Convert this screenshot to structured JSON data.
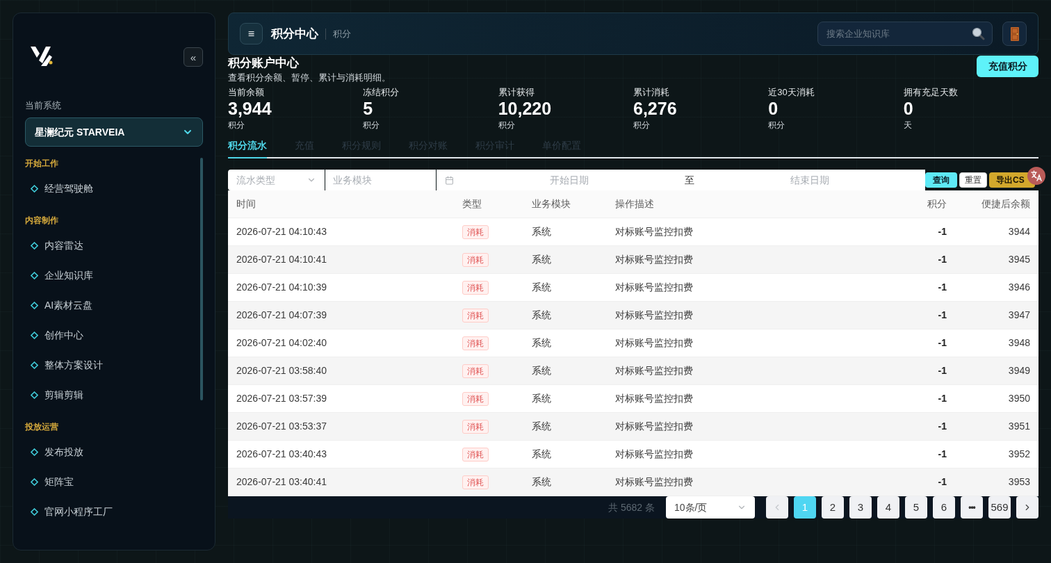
{
  "sidebar": {
    "collapse_button": "«",
    "system_label": "当前系统",
    "system_select": {
      "value": "星澜纪元 STARVEIA"
    },
    "sections": [
      {
        "title": "开始工作",
        "items": [
          {
            "label": "经营驾驶舱",
            "selected": false
          }
        ]
      },
      {
        "title": "内容制作",
        "items": [
          {
            "label": "内容雷达",
            "selected": false
          },
          {
            "label": "企业知识库",
            "selected": false
          },
          {
            "label": "AI素材云盘",
            "selected": false
          },
          {
            "label": "创作中心",
            "selected": false
          },
          {
            "label": "整体方案设计",
            "selected": false
          },
          {
            "label": "剪辑剪辑",
            "selected": false
          }
        ]
      },
      {
        "title": "投放运营",
        "items": [
          {
            "label": "发布投放",
            "selected": false
          },
          {
            "label": "矩阵宝",
            "selected": false
          },
          {
            "label": "官网小程序工厂",
            "selected": false
          }
        ]
      }
    ]
  },
  "header": {
    "menu_button": "≡",
    "title": "积分中心",
    "breadcrumb": "积分",
    "search": {
      "placeholder": "搜索企业知识库"
    }
  },
  "account": {
    "title": "积分账户中心",
    "subtitle": "查看积分余额、暂停、累计与消耗明细。",
    "recharge_button": "充值积分"
  },
  "stats": [
    {
      "label": "当前余额",
      "value": "3,944",
      "unit": "积分"
    },
    {
      "label": "冻结积分",
      "value": "5",
      "unit": "积分"
    },
    {
      "label": "累计获得",
      "value": "10,220",
      "unit": "积分"
    },
    {
      "label": "累计消耗",
      "value": "6,276",
      "unit": "积分"
    },
    {
      "label": "近30天消耗",
      "value": "0",
      "unit": "积分"
    },
    {
      "label": "拥有充足天数",
      "value": "0",
      "unit": "天"
    }
  ],
  "tabs": [
    {
      "label": "积分流水",
      "selected": true
    },
    {
      "label": "充值",
      "selected": false
    },
    {
      "label": "积分规则",
      "selected": false
    },
    {
      "label": "积分对账",
      "selected": false
    },
    {
      "label": "积分审计",
      "selected": false
    },
    {
      "label": "单价配置",
      "selected": false
    }
  ],
  "filters": {
    "type_select": {
      "placeholder": "流水类型"
    },
    "module_input": {
      "placeholder": "业务模块"
    },
    "date_range": {
      "start_placeholder": "开始日期",
      "separator": "至",
      "end_placeholder": "结束日期"
    },
    "buttons": [
      {
        "label": "查询",
        "kind": "primary"
      },
      {
        "label": "重置",
        "kind": "default"
      },
      {
        "label": "导出CS",
        "kind": "export"
      }
    ]
  },
  "table": {
    "columns": [
      "时间",
      "类型",
      "业务模块",
      "操作描述",
      "积分",
      "便捷后余额"
    ],
    "rows": [
      {
        "time": "2026-07-21 04:10:43",
        "type": "消耗",
        "module": "系统",
        "description": "对标账号监控扣费",
        "points": "-1",
        "balance": "3944"
      },
      {
        "time": "2026-07-21 04:10:41",
        "type": "消耗",
        "module": "系统",
        "description": "对标账号监控扣费",
        "points": "-1",
        "balance": "3945"
      },
      {
        "time": "2026-07-21 04:10:39",
        "type": "消耗",
        "module": "系统",
        "description": "对标账号监控扣费",
        "points": "-1",
        "balance": "3946"
      },
      {
        "time": "2026-07-21 04:07:39",
        "type": "消耗",
        "module": "系统",
        "description": "对标账号监控扣费",
        "points": "-1",
        "balance": "3947"
      },
      {
        "time": "2026-07-21 04:02:40",
        "type": "消耗",
        "module": "系统",
        "description": "对标账号监控扣费",
        "points": "-1",
        "balance": "3948"
      },
      {
        "time": "2026-07-21 03:58:40",
        "type": "消耗",
        "module": "系统",
        "description": "对标账号监控扣费",
        "points": "-1",
        "balance": "3949"
      },
      {
        "time": "2026-07-21 03:57:39",
        "type": "消耗",
        "module": "系统",
        "description": "对标账号监控扣费",
        "points": "-1",
        "balance": "3950"
      },
      {
        "time": "2026-07-21 03:53:37",
        "type": "消耗",
        "module": "系统",
        "description": "对标账号监控扣费",
        "points": "-1",
        "balance": "3951"
      },
      {
        "time": "2026-07-21 03:40:43",
        "type": "消耗",
        "module": "系统",
        "description": "对标账号监控扣费",
        "points": "-1",
        "balance": "3952"
      },
      {
        "time": "2026-07-21 03:40:41",
        "type": "消耗",
        "module": "系统",
        "description": "对标账号监控扣费",
        "points": "-1",
        "balance": "3953"
      }
    ]
  },
  "pagination": {
    "total": "共 5682 条",
    "page_size": "10条/页",
    "prev": {
      "disabled": true
    },
    "next": {
      "disabled": false
    },
    "pages": [
      {
        "label": "1",
        "kind": "page",
        "selected": true
      },
      {
        "label": "2",
        "kind": "page",
        "selected": false
      },
      {
        "label": "3",
        "kind": "page",
        "selected": false
      },
      {
        "label": "4",
        "kind": "page",
        "selected": false
      },
      {
        "label": "5",
        "kind": "page",
        "selected": false
      },
      {
        "label": "6",
        "kind": "page",
        "selected": false
      },
      {
        "label": "•••",
        "kind": "ellipsis",
        "selected": false
      },
      {
        "label": "569",
        "kind": "page",
        "selected": false
      }
    ]
  }
}
